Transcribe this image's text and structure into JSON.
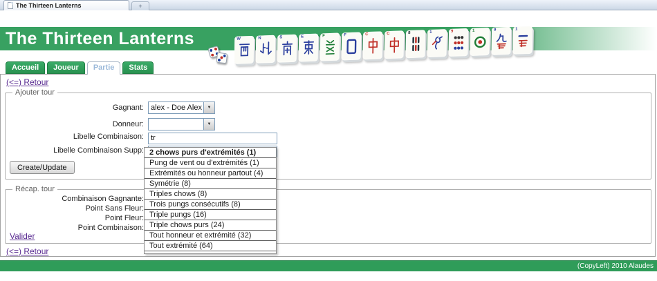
{
  "browser": {
    "tab_title": "The Thirteen Lanterns",
    "new_tab_label": "+"
  },
  "header": {
    "title": "The Thirteen Lanterns"
  },
  "nav": {
    "tabs": [
      {
        "label": "Accueil",
        "active": false
      },
      {
        "label": "Joueur",
        "active": false
      },
      {
        "label": "Partie",
        "active": true
      },
      {
        "label": "Stats",
        "active": false
      }
    ]
  },
  "page": {
    "back_link_top": "(<=) Retour",
    "back_link_bottom": "(<=) Retour"
  },
  "add_round": {
    "legend": "Ajouter tour",
    "submit_label": "Create/Update",
    "fields": [
      {
        "label": "Gagnant:",
        "type": "select",
        "value": "alex - Doe Alex"
      },
      {
        "label": "Donneur:",
        "type": "select",
        "value": ""
      },
      {
        "label": "Libelle Combinaison:",
        "type": "text",
        "value": "tr"
      },
      {
        "label": "Libelle Combinaison Supp:",
        "type": "text",
        "value": ""
      }
    ]
  },
  "autocomplete": {
    "items": [
      "2 chows purs d'extrémités (1)",
      "Pung de vent ou d'extrémités (1)",
      "Extrémités ou honneur partout (4)",
      "Symétrie (8)",
      "Triples chows (8)",
      "Trois pungs consécutifs (8)",
      "Triple pungs (16)",
      "Triple chows purs (24)",
      "Tout honneur et extrémité (32)",
      "Tout extrémité (64)"
    ]
  },
  "recap": {
    "legend": "Récap. tour",
    "labels": [
      "Combinaison Gagnante:",
      "Point Sans Fleur:",
      "Point Fleur:",
      "Point Combinaison:"
    ],
    "validate_label": "Valider"
  },
  "footer": {
    "text": "(CopyLeft) 2010 Alaudes"
  },
  "colors": {
    "header_green": "#38a161",
    "tab_green": "#2f9c59",
    "link_purple": "#5a2c92",
    "active_tab_text": "#9bb9da"
  },
  "tiles": [
    {
      "name": "west-wind-tile",
      "shape": "west",
      "mark": "W",
      "color": "#2b3f9e"
    },
    {
      "name": "north-wind-tile",
      "shape": "north",
      "mark": "N",
      "color": "#2b3f9e"
    },
    {
      "name": "south-wind-tile",
      "shape": "south",
      "mark": "S",
      "color": "#2b3f9e"
    },
    {
      "name": "east-wind-tile",
      "shape": "east",
      "mark": "E",
      "color": "#2b3f9e"
    },
    {
      "name": "green-dragon-tile",
      "shape": "green",
      "mark": "F",
      "color": "#1e7d36"
    },
    {
      "name": "white-dragon-tile",
      "shape": "white",
      "mark": "F",
      "color": "#2b3f9e"
    },
    {
      "name": "red-dragon-tile",
      "shape": "chung",
      "mark": "C",
      "color": "#c03028"
    },
    {
      "name": "red-dragon-tile",
      "shape": "chung",
      "mark": "C",
      "color": "#c03028"
    },
    {
      "name": "bamboo-8-tile",
      "shape": "bamboo8",
      "mark": "8",
      "color": "#22313a"
    },
    {
      "name": "bamboo-1-bird-tile",
      "shape": "bird",
      "mark": "1",
      "color": "#2b3f9e"
    },
    {
      "name": "circles-9-tile",
      "shape": "dots9",
      "mark": "9",
      "color": "#c03028"
    },
    {
      "name": "circle-1-tile",
      "shape": "dot1",
      "mark": "1",
      "color": "#1e7d36"
    },
    {
      "name": "character-9-tile",
      "shape": "man9",
      "mark": "9",
      "color": "#2b3f9e"
    },
    {
      "name": "character-1-tile",
      "shape": "man1",
      "mark": "1",
      "color": "#2b3f9e"
    }
  ]
}
